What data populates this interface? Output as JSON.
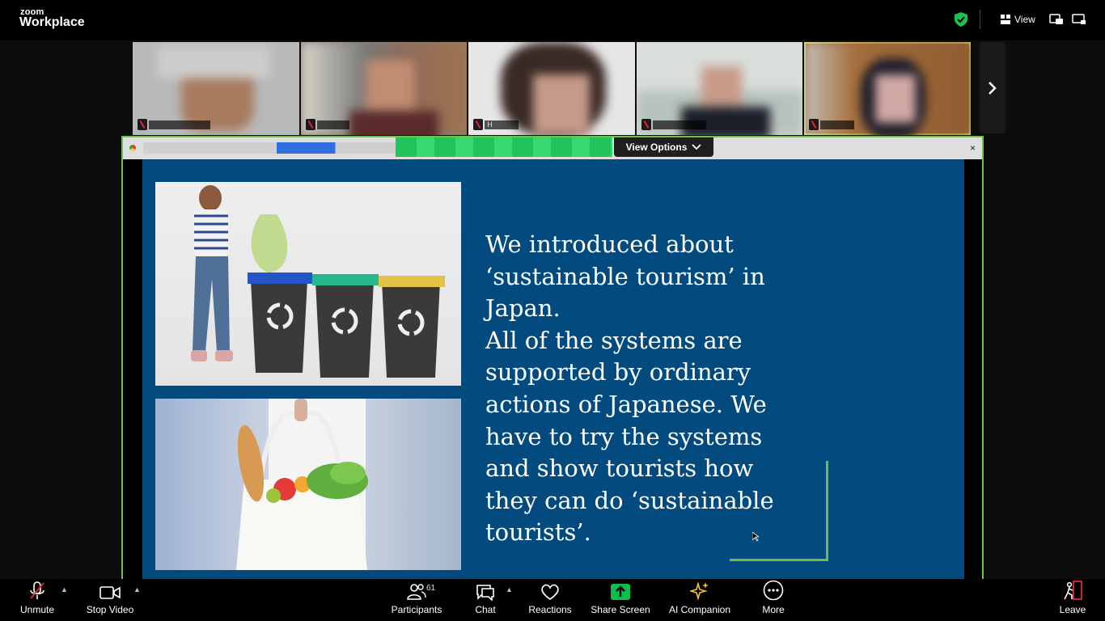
{
  "app": {
    "logo_top": "zoom",
    "logo_bottom": "Workplace"
  },
  "topbar": {
    "view_label": "View"
  },
  "thumbnails": [
    {
      "name": ""
    },
    {
      "name": ""
    },
    {
      "name": "H"
    },
    {
      "name": ""
    },
    {
      "name": ""
    }
  ],
  "share": {
    "view_options_label": "View Options",
    "close_symbol": "×"
  },
  "slide": {
    "text": "We introduced about\n‘sustainable tourism’ in\nJapan.\nAll of the systems are\nsupported by ordinary\nactions of Japanese. We\nhave to try the systems\nand show  tourists how\nthey can do ‘sustainable\ntourists’."
  },
  "toolbar": {
    "unmute": "Unmute",
    "stop_video": "Stop Video",
    "participants": "Participants",
    "participants_count": "61",
    "chat": "Chat",
    "reactions": "Reactions",
    "share_screen": "Share Screen",
    "ai_companion": "AI Companion",
    "more": "More",
    "leave": "Leave"
  },
  "colors": {
    "share_border": "#6dc24b",
    "slide_bg": "#034b7f",
    "share_screen_green": "#0bbd4c",
    "leave_red": "#e0283a"
  }
}
